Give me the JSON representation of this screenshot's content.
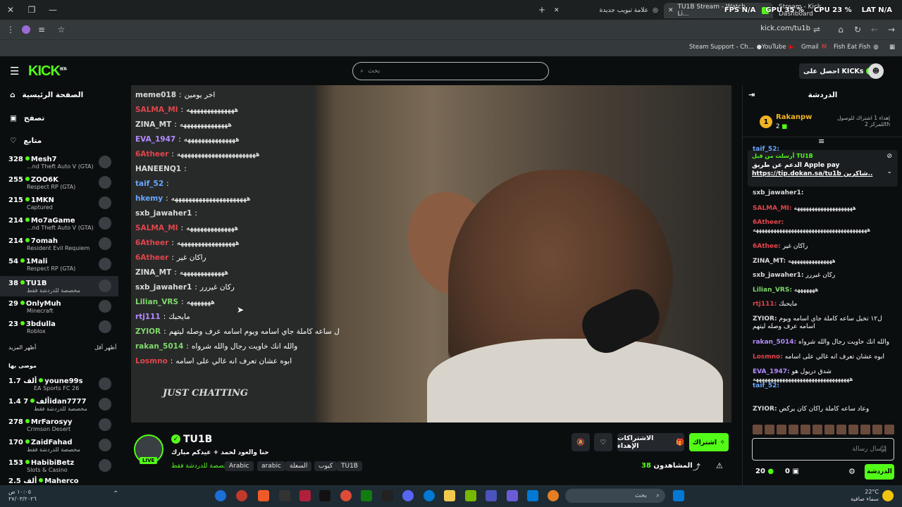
{
  "browser": {
    "tabs": [
      {
        "label": "علامة تبويب جديدة"
      },
      {
        "label": "TU1B Stream - Watch Li..."
      },
      {
        "label": "Stream - Kick Dashboard"
      }
    ],
    "overlay": {
      "fps": "FPS N/A",
      "gpu": "GPU 35 %",
      "cpu": "CPU 23 %",
      "lat": "LAT N/A"
    },
    "url": "kick.com/tu1b",
    "bookmarks": [
      "Steam Support - Ch...",
      "YouTube",
      "Gmail",
      "Fish Eat Fish"
    ]
  },
  "header": {
    "logo": "KICK",
    "logo_beta": "BETA",
    "search_placeholder": "بحث",
    "get_kicks": "احصل على KICKs"
  },
  "sidebar": {
    "nav": [
      {
        "label": "الصفحة الرئيسية",
        "icon": "home-icon"
      },
      {
        "label": "تصفح",
        "icon": "browse-icon"
      },
      {
        "label": "متابع",
        "icon": "heart-icon"
      }
    ],
    "following": [
      {
        "count": "328",
        "name": "Mesh7",
        "category": "...nd Theft Auto V (GTA)"
      },
      {
        "count": "255",
        "name": "ZOO6K",
        "category": "Respect RP (GTA)"
      },
      {
        "count": "215",
        "name": "1MKN",
        "category": "Captured"
      },
      {
        "count": "214",
        "name": "Mo7aGame",
        "category": "...nd Theft Auto V (GTA)"
      },
      {
        "count": "214",
        "name": "7omah",
        "category": "Resident Evil Requiem"
      },
      {
        "count": "54",
        "name": "1Mali",
        "category": "Respect RP (GTA)"
      },
      {
        "count": "38",
        "name": "TU1B",
        "category": "مخصصة للدردشة فقط"
      },
      {
        "count": "29",
        "name": "OnlyMuh",
        "category": "Minecraft"
      },
      {
        "count": "23",
        "name": "3bdulla",
        "category": "Roblox"
      }
    ],
    "show_more": "أظهر المزيد",
    "show_less": "أظهر أقل",
    "recommended_heading": "موصى بها",
    "recommended": [
      {
        "count": "1.7 ألف",
        "name": "youne99s",
        "category": "EA Sports FC 26"
      },
      {
        "count": "1.4 ألف",
        "name": "7idan7777",
        "category": "مخصصة للدردشة فقط"
      },
      {
        "count": "278",
        "name": "MrFarosyy",
        "category": "Crimson Desert"
      },
      {
        "count": "170",
        "name": "ZaidFahad",
        "category": "مخصصة للدردشة فقط"
      },
      {
        "count": "153",
        "name": "HabibiBetz",
        "category": "Slots & Casino"
      },
      {
        "count": "2.5 ألف",
        "name": "Maherco",
        "category": ""
      }
    ]
  },
  "video_chat": [
    {
      "user": "meme018",
      "msg": "اخر يومين",
      "color": "#dadada"
    },
    {
      "user": "SALMA_MI",
      "msg": "ههههههههههههههه",
      "color": "#e0454b"
    },
    {
      "user": "ZINA_MT",
      "msg": "ههههههههههههههه",
      "color": "#dadada"
    },
    {
      "user": "EVA_1947",
      "msg": "هههههههههههههههه",
      "color": "#b38cff"
    },
    {
      "user": "6Atheer",
      "msg": "هههههههههههههههههههههههه",
      "color": "#e0454b"
    },
    {
      "user": "HANEENQ1",
      "msg": "",
      "color": "#dadada"
    },
    {
      "user": "taif_52",
      "msg": "",
      "color": "#6aa7ff"
    },
    {
      "user": "hkemy",
      "msg": "ههههههههههههههههههههههه",
      "color": "#6aa7ff"
    },
    {
      "user": "sxb_jawaher1",
      "msg": "",
      "color": "#dadada"
    },
    {
      "user": "SALMA_MI",
      "msg": "ههههههههههههههه",
      "color": "#e0454b"
    },
    {
      "user": "6Atheer",
      "msg": "هههههههههههههههههه",
      "color": "#e0454b"
    },
    {
      "user": "6Atheer",
      "msg": "راكان غير",
      "color": "#e0454b"
    },
    {
      "user": "ZINA_MT",
      "msg": "هههههههههههههه",
      "color": "#dadada"
    },
    {
      "user": "sxb_jawaher1",
      "msg": "ركان غيررر",
      "color": "#dadada"
    },
    {
      "user": "Lilian_VRS",
      "msg": "هههههههه",
      "color": "#7fd96b"
    },
    {
      "user": "rtj111",
      "msg": "مايحبك",
      "color": "#b38cff"
    },
    {
      "user": "ZYIOR",
      "msg": "ل ساعه كاملة جاي اسامه ويوم اسامه عرف وصله ليتهم",
      "color": "#7fd96b"
    },
    {
      "user": "rakan_5014",
      "msg": "والله انك خاويت رجال والله شرواه",
      "color": "#7fd96b"
    },
    {
      "user": "Losmno",
      "msg": "ابوه عشان تعرف انه غالي على اسامه",
      "color": "#e0454b"
    }
  ],
  "video_label": "JUST CHATTING",
  "stream": {
    "channel": "TU1B",
    "live": "LIVE",
    "title": "حنا والعود لحمد + عيدكم مبارك",
    "category": "مخصصة للدردشة فقط",
    "tags": [
      "Arabic",
      "arabic",
      "السعلة",
      "كيوب",
      "TU1B"
    ],
    "subscribe": "اشتراك",
    "gift_subs": "الاشتراكات الإهداء",
    "viewers_label": "المشاهدون",
    "viewers": "38"
  },
  "chat": {
    "title": "الدردشة",
    "leader_rank": "1",
    "leader_name": "Rakanpw",
    "leader_count": "2",
    "leader_gift": "إهداء 1 اشتراك للوصول للمركز 2th",
    "pinned_by": "أرسلت من قبل TU1B",
    "pinned_text": "الدعم عن طريق Apple pay",
    "pinned_link": "https://tip.dokan.sa/tu1b",
    "pinned_suffix": "شاكرين..",
    "messages": [
      {
        "user": "taif_52:",
        "msg": "",
        "color": "#6aa7ff"
      },
      {
        "user": "sxb_jawaher1:",
        "msg": "",
        "color": "#dadada"
      },
      {
        "user": "SALMA_MI:",
        "msg": "ههههههههههههههههههههه",
        "color": "#e0454b"
      },
      {
        "user": "6Atheer:",
        "msg": "هههههههههههههههههههههههههههههههههههههههه",
        "color": "#e0454b"
      },
      {
        "user": "6Athee:",
        "msg": "راكان غير",
        "color": "#e0454b"
      },
      {
        "user": "ZINA_MT:",
        "msg": "هههههههههههههههه",
        "color": "#dadada"
      },
      {
        "user": "sxb_jawaher1:",
        "msg": "ركان غيررر",
        "color": "#dadada"
      },
      {
        "user": "Lilian_VRS:",
        "msg": "هههههههه",
        "color": "#7fd96b"
      },
      {
        "user": "rtj111:",
        "msg": "مايحبك",
        "color": "#e0454b"
      },
      {
        "user": "ZYIOR:",
        "msg": "ل١٢ تخيل ساعه كاملة جاي اسامه ويوم اسامه عرف وصله ليتهم",
        "color": "#dadada"
      },
      {
        "user": "rakan_5014:",
        "msg": "والله انك خاويت رجال والله شرواه",
        "color": "#b38cff"
      },
      {
        "user": "Losmno:",
        "msg": "ابوه عشان تعرف انه غالي على اسامه",
        "color": "#e0454b"
      },
      {
        "user": "EVA_1947:",
        "msg": "شدق دريول هو هههههههههههههههههههههههههههههههههه",
        "color": "#b38cff"
      },
      {
        "user": "taif_52:",
        "msg": "",
        "color": "#6aa7ff"
      },
      {
        "user": "ZYIOR:",
        "msg": "وعاد ساعه كاملة راكان كان يركض",
        "color": "#dadada"
      }
    ],
    "input_placeholder": "إرسال رسالة",
    "points": "20",
    "kicks": "0",
    "chat_button": "الدردشة"
  },
  "taskbar": {
    "time": "١٠:٠٥ ص",
    "date": "٢٧/٠٣/٢٠٢٦",
    "search": "بحث",
    "temp": "22°C",
    "weather": "سماء صافية"
  }
}
